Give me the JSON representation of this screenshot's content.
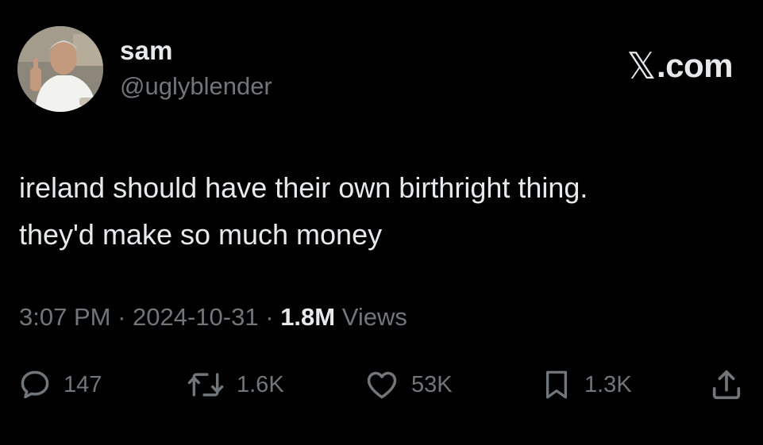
{
  "user": {
    "display_name": "sam",
    "handle": "@uglyblender"
  },
  "brand": {
    "text": ".com",
    "icon": "x-logo-icon"
  },
  "tweet": {
    "lines": [
      "ireland should have their own birthright thing.",
      "they'd make so much money"
    ]
  },
  "meta": {
    "time": "3:07 PM",
    "separator": "·",
    "date": "2024-10-31",
    "views_count": "1.8M",
    "views_label": "Views"
  },
  "actions": {
    "reply": {
      "icon": "reply-icon",
      "count": "147"
    },
    "repost": {
      "icon": "repost-icon",
      "count": "1.6K"
    },
    "like": {
      "icon": "heart-icon",
      "count": "53K"
    },
    "bookmark": {
      "icon": "bookmark-icon",
      "count": "1.3K"
    },
    "share": {
      "icon": "share-icon"
    }
  },
  "colors": {
    "background": "#000000",
    "primary_text": "#e7e9ea",
    "secondary_text": "#71767b"
  }
}
